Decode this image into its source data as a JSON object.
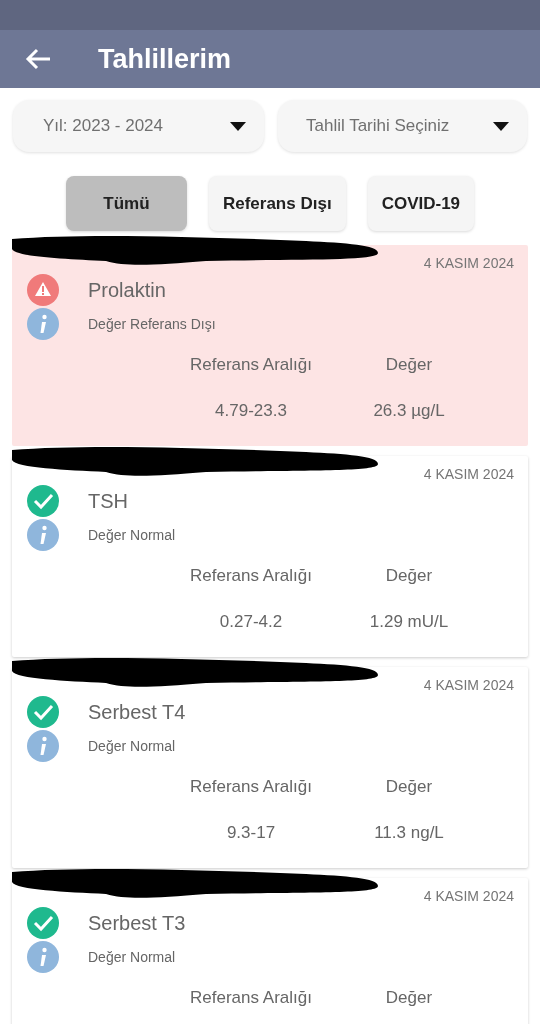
{
  "app_bar": {
    "title": "Tahlillerim"
  },
  "dropdowns": [
    {
      "value": "Yıl: 2023 - 2024"
    },
    {
      "value": "Tahlil Tarihi Seçiniz"
    }
  ],
  "filters": [
    {
      "label": "Tümü",
      "selected": true
    },
    {
      "label": "Referans Dışı",
      "selected": false
    },
    {
      "label": "COVID-19",
      "selected": false
    }
  ],
  "results": [
    {
      "kind": "out_of_range",
      "redacted": true,
      "date": "4 KASIM 2024",
      "test": "Prolaktin",
      "status": "Değer Referans Dışı",
      "range_label": "Referans Aralığı",
      "value_label": "Değer",
      "range": "4.79-23.3",
      "value": "26.3 µg/L"
    },
    {
      "kind": "normal",
      "redacted": true,
      "date": "4 KASIM 2024",
      "test": "TSH",
      "status": "Değer Normal",
      "range_label": "Referans Aralığı",
      "value_label": "Değer",
      "range": "0.27-4.2",
      "value": "1.29 mU/L"
    },
    {
      "kind": "normal",
      "redacted": true,
      "date": "4 KASIM 2024",
      "test": "Serbest T4",
      "status": "Değer Normal",
      "range_label": "Referans Aralığı",
      "value_label": "Değer",
      "range": "9.3-17",
      "value": "11.3 ng/L"
    },
    {
      "kind": "normal",
      "redacted": true,
      "date": "4 KASIM 2024",
      "test": "Serbest T3",
      "status": "Değer Normal",
      "range_label": "Referans Aralığı",
      "value_label": "Değer"
    }
  ]
}
